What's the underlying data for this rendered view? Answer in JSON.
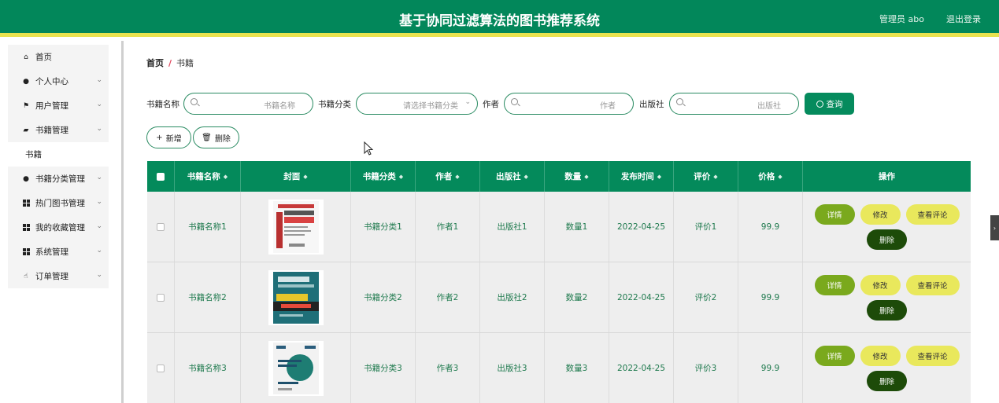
{
  "header": {
    "title": "基于协同过滤算法的图书推荐系统",
    "user": "管理员 abo",
    "logout": "退出登录"
  },
  "sidebar": {
    "items": [
      {
        "label": "首页",
        "icon": "home-icon"
      },
      {
        "label": "个人中心",
        "icon": "person-icon"
      },
      {
        "label": "用户管理",
        "icon": "flag-icon"
      },
      {
        "label": "书籍管理",
        "icon": "briefcase-icon"
      },
      {
        "label": "书籍",
        "icon": ""
      },
      {
        "label": "书籍分类管理",
        "icon": "person-icon"
      },
      {
        "label": "热门图书管理",
        "icon": "grid-icon"
      },
      {
        "label": "我的收藏管理",
        "icon": "grid-icon"
      },
      {
        "label": "系统管理",
        "icon": "grid-icon"
      },
      {
        "label": "订单管理",
        "icon": "thumb-icon"
      }
    ]
  },
  "breadcrumb": {
    "home": "首页",
    "sep": "/",
    "current": "书籍"
  },
  "search": {
    "name_label": "书籍名称",
    "name_placeholder": "书籍名称",
    "category_label": "书籍分类",
    "category_placeholder": "请选择书籍分类",
    "author_label": "作者",
    "author_placeholder": "作者",
    "publisher_label": "出版社",
    "publisher_placeholder": "出版社",
    "query_button": "查询"
  },
  "actions": {
    "add": "新增",
    "delete": "删除"
  },
  "table": {
    "headers": [
      "书籍名称",
      "封面",
      "书籍分类",
      "作者",
      "出版社",
      "数量",
      "发布时间",
      "评价",
      "价格",
      "操作"
    ],
    "rows": [
      {
        "name": "书籍名称1",
        "category": "书籍分类1",
        "author": "作者1",
        "publisher": "出版社1",
        "count": "数量1",
        "date": "2022-04-25",
        "review": "评价1",
        "price": "99.9"
      },
      {
        "name": "书籍名称2",
        "category": "书籍分类2",
        "author": "作者2",
        "publisher": "出版社2",
        "count": "数量2",
        "date": "2022-04-25",
        "review": "评价2",
        "price": "99.9"
      },
      {
        "name": "书籍名称3",
        "category": "书籍分类3",
        "author": "作者3",
        "publisher": "出版社3",
        "count": "数量3",
        "date": "2022-04-25",
        "review": "评价3",
        "price": "99.9"
      }
    ],
    "ops": {
      "detail": "详情",
      "edit": "修改",
      "review": "查看评论",
      "delete": "删除"
    }
  },
  "colors": {
    "primary": "#048a5b",
    "accent": "#e9e34f",
    "delete": "#1d4b09"
  }
}
